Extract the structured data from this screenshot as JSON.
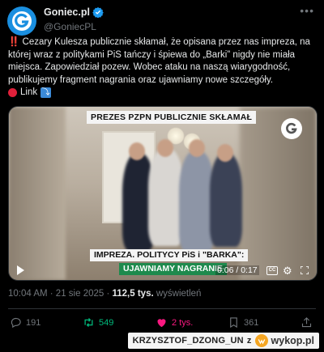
{
  "header": {
    "name": "Goniec.pl",
    "handle": "@GoniecPL"
  },
  "text": {
    "bangs": "‼️",
    "line1": " Cezary Kulesza publicznie skłamał, że opisana przez nas impreza, na której wraz z politykami PiS tańczy i śpiewa do „Barki” nigdy nie miała miejsca. Zapowiedział  pozew. Wobec ataku na naszą wiarygodność, publikujemy fragment nagrania oraz ujawniamy nowe szczegóły.",
    "link_label": "Link",
    "link_arrow": "⤵"
  },
  "video": {
    "title": "PREZES PZPN PUBLICZNIE SKŁAMAŁ",
    "caption1": "IMPREZA. POLITYCY PiS i \"BARKA\":",
    "caption2": "UJAWNIAMY NAGRANIE",
    "time": "0:06 / 0:17",
    "logo_letter": "G",
    "cc_label": "CC"
  },
  "meta": {
    "time": "10:04 AM · 21 sie 2025 · ",
    "views": "112,5 tys.",
    "views_label": " wyświetleń"
  },
  "actions": {
    "replies": "191",
    "retweets": "549",
    "likes": "2 tys.",
    "bookmarks": "361"
  },
  "watermark": {
    "user": "KRZYSZTOF_DZONG_UN",
    "connector": "z",
    "site": "wykop.pl"
  },
  "colors": {
    "accent": "#1d9bf0",
    "retweet": "#00ba7c",
    "like": "#f91880",
    "caption_green": "#1e8a4d"
  },
  "icons": [
    "goniec-logo",
    "verified-badge-icon",
    "more-icon",
    "play-icon",
    "cc-icon",
    "gear-icon",
    "fullscreen-icon",
    "reply-icon",
    "retweet-icon",
    "like-icon",
    "bookmark-icon",
    "share-icon"
  ]
}
